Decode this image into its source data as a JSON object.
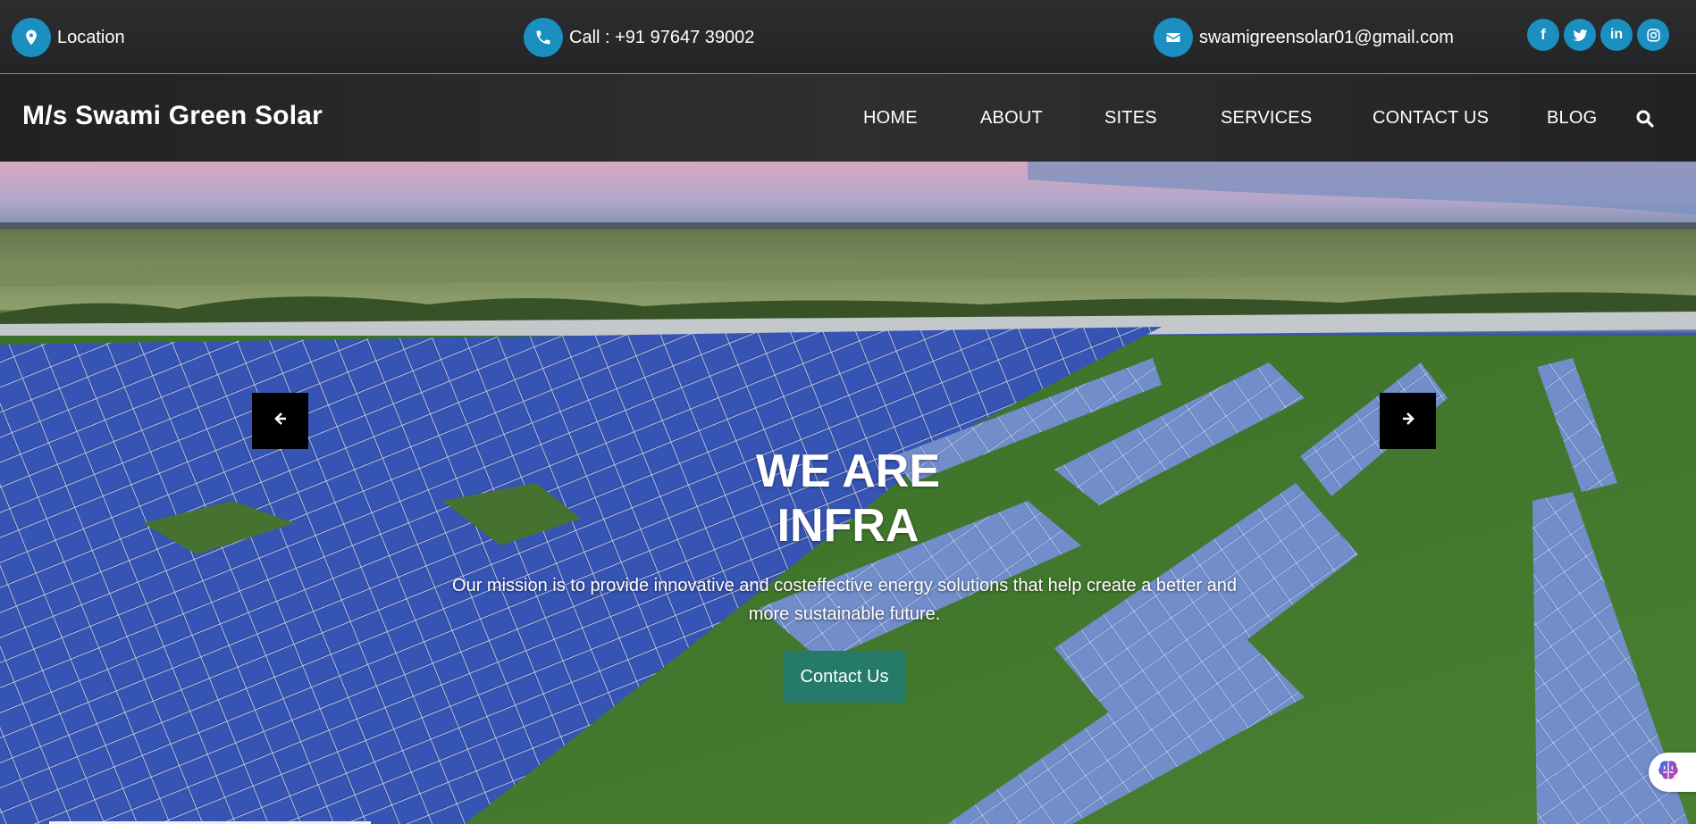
{
  "topbar": {
    "location": {
      "icon": "map-marker-icon",
      "label": "Location"
    },
    "phone": {
      "icon": "phone-icon",
      "label": "Call : +91 97647 39002"
    },
    "email": {
      "icon": "envelope-icon",
      "label": "swamigreensolar01@gmail.com"
    },
    "social": [
      {
        "icon": "facebook-icon",
        "glyph": "f"
      },
      {
        "icon": "twitter-icon"
      },
      {
        "icon": "linkedin-icon",
        "glyph": "in"
      },
      {
        "icon": "instagram-icon"
      }
    ],
    "accent_color": "#1b8fbf"
  },
  "navbar": {
    "brand": "M/s Swami Green Solar",
    "items": [
      "HOME",
      "ABOUT",
      "SITES",
      "SERVICES",
      "CONTACT US",
      "BLOG"
    ],
    "search_icon": "search-icon"
  },
  "hero": {
    "title_line1": "WE ARE",
    "title_line2": "INFRA",
    "subtitle": "Our mission is to provide innovative and costeffective energy solutions that help create a better and more sustainable future.",
    "cta": "Contact Us",
    "cta_color": "#257a6a",
    "prev_icon": "arrow-left-icon",
    "next_icon": "arrow-right-icon"
  },
  "widget": {
    "icon": "brain-icon"
  }
}
